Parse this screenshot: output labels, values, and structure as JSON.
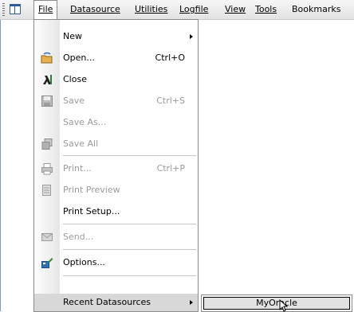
{
  "menubar": {
    "items": [
      {
        "label": "File",
        "accel_index": 0
      },
      {
        "label": "Datasource",
        "accel_index": 0
      },
      {
        "label": "Utilities",
        "accel_index": 0
      },
      {
        "label": "Logfile",
        "accel_index": 0
      },
      {
        "label": "View",
        "accel_index": 0
      },
      {
        "label": "Tools",
        "accel_index": 0
      },
      {
        "label": "Bookmarks",
        "accel_index": 7
      }
    ]
  },
  "file_menu": {
    "new_label": "New",
    "open_label": "Open...",
    "open_shortcut": "Ctrl+O",
    "close_label": "Close",
    "save_label": "Save",
    "save_shortcut": "Ctrl+S",
    "save_as_label": "Save As...",
    "save_all_label": "Save All",
    "print_label": "Print...",
    "print_shortcut": "Ctrl+P",
    "print_preview_label": "Print Preview",
    "print_setup_label": "Print Setup...",
    "send_label": "Send...",
    "options_label": "Options...",
    "recent_label": "Recent Datasources"
  },
  "recent_submenu": {
    "items": [
      "MyOracle"
    ]
  },
  "icons": {
    "open": "open-folder-icon",
    "close": "close-icon",
    "save": "save-disk-icon",
    "save_all": "save-all-icon",
    "print": "printer-icon",
    "print_preview": "print-preview-icon",
    "send": "mail-icon",
    "options": "options-icon"
  },
  "colors": {
    "highlight": "#d8d8d8",
    "disabled_text": "#9a9a9a",
    "menu_border": "#8a8a8a"
  }
}
